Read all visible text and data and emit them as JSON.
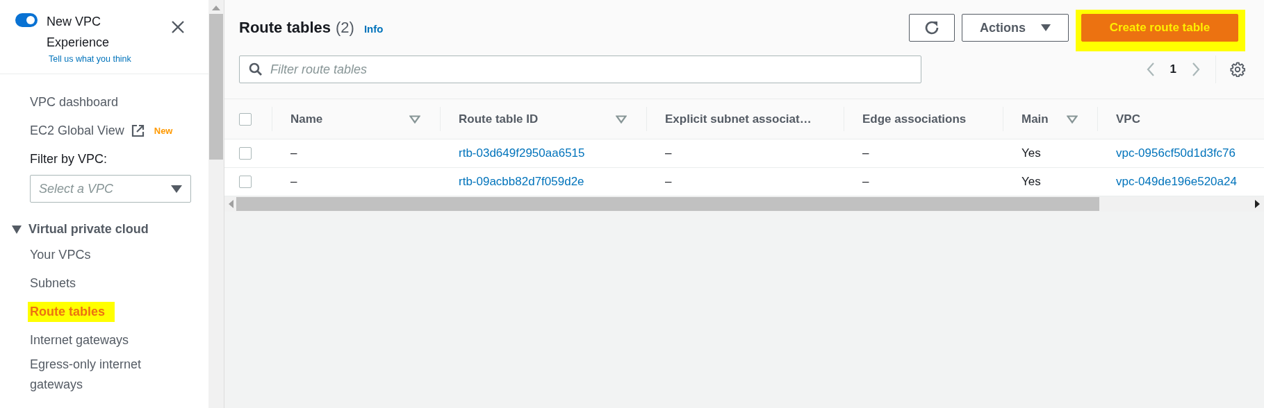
{
  "sidebar": {
    "experience_toggle": {
      "label": "New VPC Experience",
      "on": true
    },
    "feedback_link": "Tell us what you think",
    "items": [
      {
        "label": "VPC dashboard",
        "kind": "link",
        "selected": false,
        "highlighted": false
      },
      {
        "label": "EC2 Global View",
        "kind": "external",
        "badge": "New",
        "selected": false,
        "highlighted": false
      }
    ],
    "filter": {
      "label": "Filter by VPC:",
      "placeholder": "Select a VPC"
    },
    "section": {
      "label": "Virtual private cloud",
      "expanded": true,
      "children": [
        {
          "label": "Your VPCs",
          "selected": false,
          "highlighted": false
        },
        {
          "label": "Subnets",
          "selected": false,
          "highlighted": false
        },
        {
          "label": "Route tables",
          "selected": true,
          "highlighted": true
        },
        {
          "label": "Internet gateways",
          "selected": false,
          "highlighted": false
        },
        {
          "label": "Egress-only internet gateways",
          "selected": false,
          "highlighted": false
        }
      ]
    }
  },
  "header": {
    "title": "Route tables",
    "count": "(2)",
    "info": "Info",
    "actions_button": "Actions",
    "create_button": {
      "label": "Create route table",
      "highlighted": true
    }
  },
  "search": {
    "placeholder": "Filter route tables"
  },
  "pagination": {
    "page": "1"
  },
  "table": {
    "all_checked": false,
    "columns": [
      {
        "label": "Name",
        "sortable": true
      },
      {
        "label": "Route table ID",
        "sortable": true
      },
      {
        "label": "Explicit subnet associat…",
        "sortable": false
      },
      {
        "label": "Edge associations",
        "sortable": false
      },
      {
        "label": "Main",
        "sortable": true
      },
      {
        "label": "VPC",
        "sortable": false
      }
    ],
    "rows": [
      {
        "checked": false,
        "cells": [
          "–",
          "rtb-03d649f2950aa6515",
          "–",
          "–",
          "Yes",
          "vpc-0956cf50d1d3fc76"
        ]
      },
      {
        "checked": false,
        "cells": [
          "–",
          "rtb-09acbb82d7f059d2e",
          "–",
          "–",
          "Yes",
          "vpc-049de196e520a24"
        ]
      }
    ]
  }
}
